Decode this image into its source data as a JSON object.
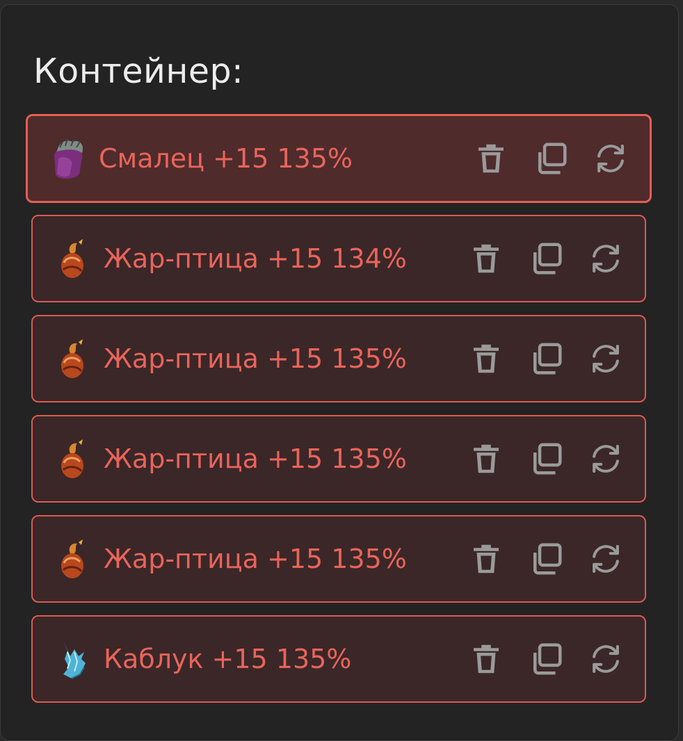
{
  "container": {
    "title": "Контейнер:"
  },
  "items": [
    {
      "label": "Смалец +15 135%",
      "icon": "lard-icon",
      "selected": true
    },
    {
      "label": "Жар-птица +15 134%",
      "icon": "firebird-icon",
      "selected": false
    },
    {
      "label": "Жар-птица +15 135%",
      "icon": "firebird-icon",
      "selected": false
    },
    {
      "label": "Жар-птица +15 135%",
      "icon": "firebird-icon",
      "selected": false
    },
    {
      "label": "Жар-птица +15 135%",
      "icon": "firebird-icon",
      "selected": false
    },
    {
      "label": "Каблук +15 135%",
      "icon": "heel-icon",
      "selected": false
    }
  ],
  "actions": [
    "trash-icon",
    "copy-icon",
    "refresh-icon"
  ],
  "colors": {
    "accent": "#e9645b",
    "border": "#dd5a52",
    "item_bg": "#3b2728",
    "item_selected_bg": "#4f2b2c",
    "panel_bg": "#232323",
    "icon_gray": "#9a9a9a"
  }
}
